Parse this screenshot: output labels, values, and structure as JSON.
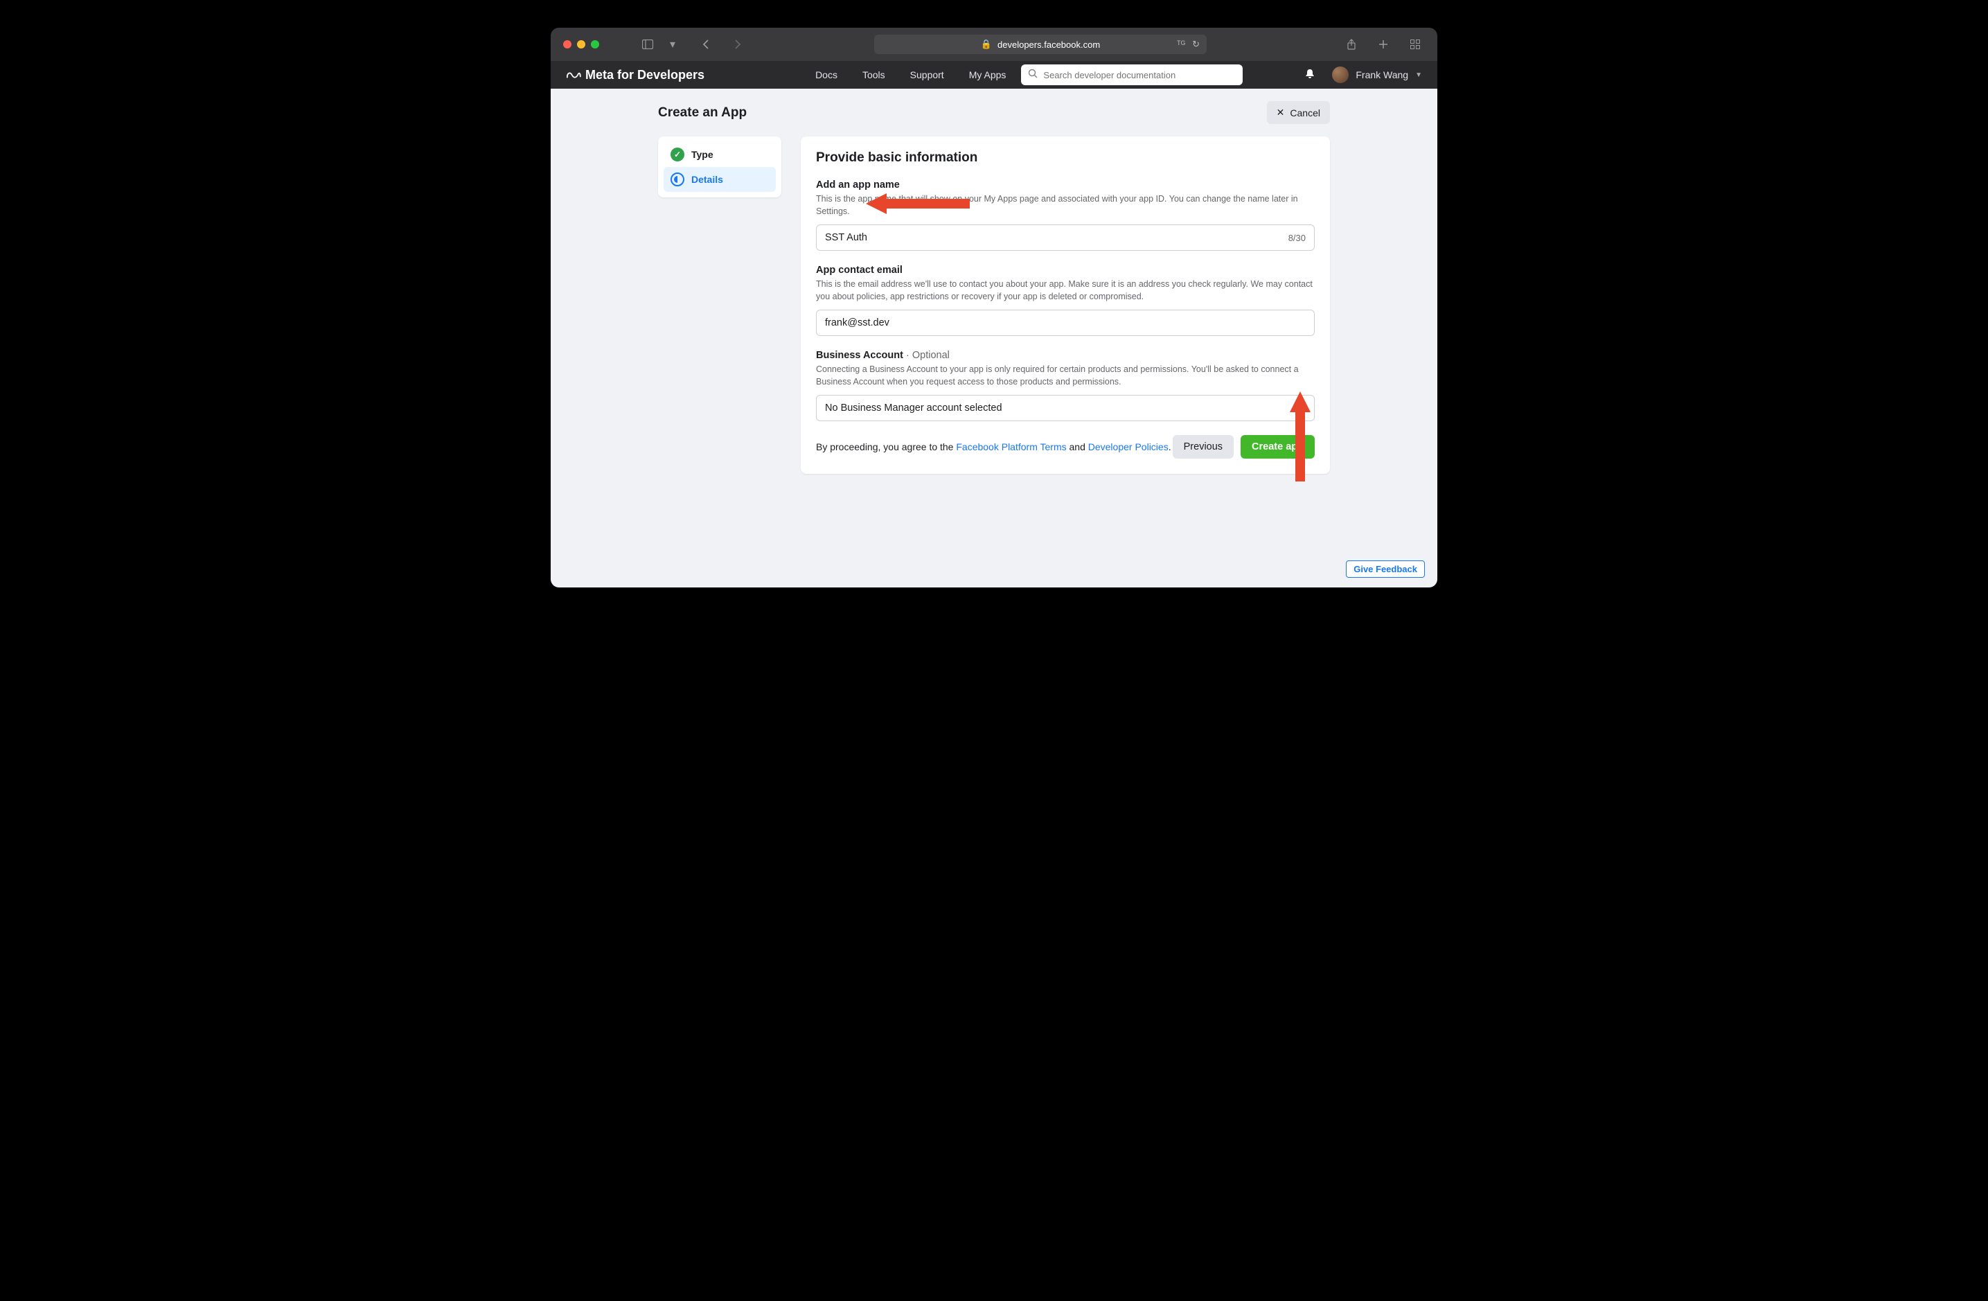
{
  "browser": {
    "url": "developers.facebook.com"
  },
  "header": {
    "brand": "Meta for Developers",
    "nav": [
      "Docs",
      "Tools",
      "Support",
      "My Apps"
    ],
    "search_placeholder": "Search developer documentation",
    "user_name": "Frank Wang"
  },
  "page": {
    "title": "Create an App",
    "cancel": "Cancel"
  },
  "sidebar": {
    "steps": [
      {
        "label": "Type"
      },
      {
        "label": "Details"
      }
    ]
  },
  "form": {
    "heading": "Provide basic information",
    "name": {
      "label": "Add an app name",
      "help": "This is the app name that will show on your My Apps page and associated with your app ID. You can change the name later in Settings.",
      "value": "SST Auth",
      "counter": "8/30"
    },
    "email": {
      "label": "App contact email",
      "help": "This is the email address we'll use to contact you about your app. Make sure it is an address you check regularly. We may contact you about policies, app restrictions or recovery if your app is deleted or compromised.",
      "value": "frank@sst.dev"
    },
    "ba": {
      "label": "Business Account",
      "optional": " · Optional",
      "help": "Connecting a Business Account to your app is only required for certain products and permissions. You'll be asked to connect a Business Account when you request access to those products and permissions.",
      "selected": "No Business Manager account selected"
    },
    "agree": {
      "prefix": "By proceeding, you agree to the ",
      "link1": "Facebook Platform Terms",
      "and": " and ",
      "link2": "Developer Policies",
      "suffix": "."
    },
    "previous": "Previous",
    "create": "Create app"
  },
  "feedback": "Give Feedback",
  "colors": {
    "accent": "#1877f2",
    "success": "#42b72a",
    "arrow": "#e8462b"
  }
}
